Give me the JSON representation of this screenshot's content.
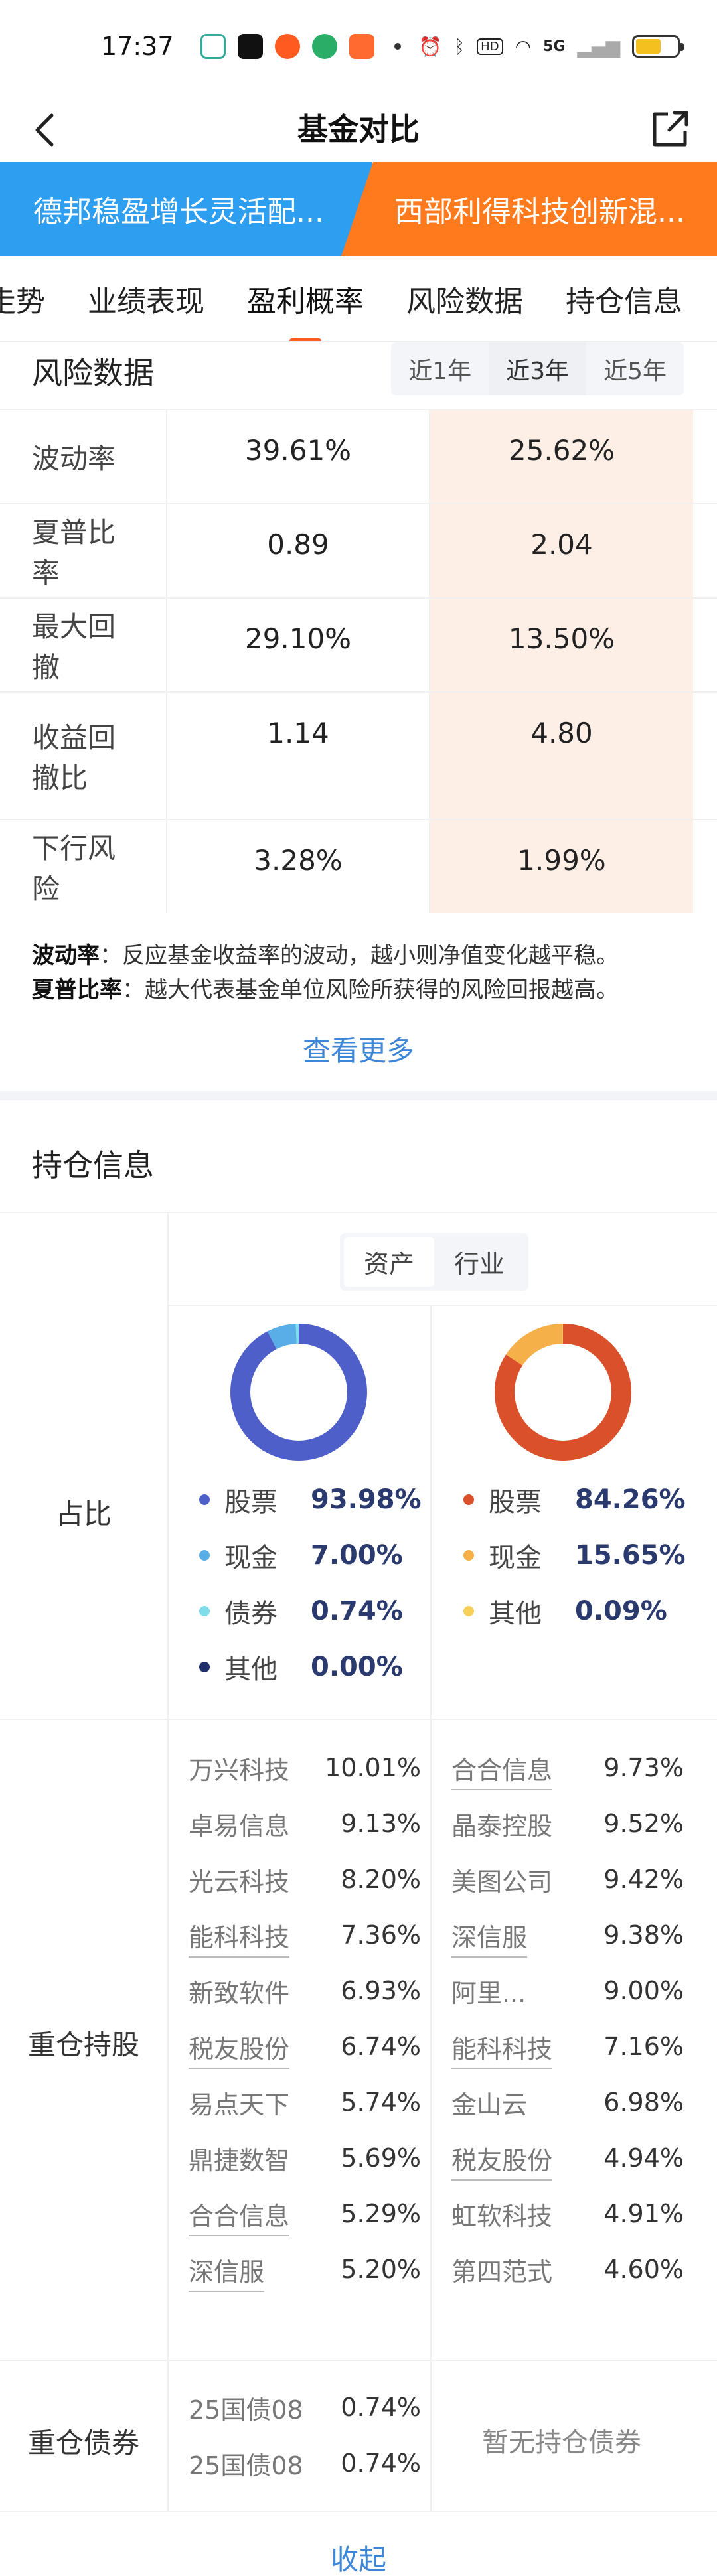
{
  "status_bar": {
    "time": "17:37",
    "net_label": "HD",
    "signal_label": "5G"
  },
  "header": {
    "title": "基金对比"
  },
  "funds": {
    "a": "德邦稳盈增长灵活配...",
    "b": "西部利得科技创新混..."
  },
  "tabs": [
    "走势",
    "业绩表现",
    "盈利概率",
    "风险数据",
    "持仓信息"
  ],
  "active_tab": "盈利概率",
  "risk": {
    "title": "风险数据",
    "periods": [
      "近1年",
      "近3年",
      "近5年"
    ],
    "selected_period": "近3年",
    "rows": [
      {
        "label": "波动率",
        "a": "39.61%",
        "b": "25.62%"
      },
      {
        "label": "夏普比率",
        "a": "0.89",
        "b": "2.04"
      },
      {
        "label": "最大回撤",
        "a": "29.10%",
        "b": "13.50%"
      },
      {
        "label": "收益回撤比",
        "a": "1.14",
        "b": "4.80"
      },
      {
        "label": "下行风险",
        "a": "3.28%",
        "b": "1.99%"
      }
    ],
    "notes": [
      {
        "term": "波动率",
        "text": "：反应基金收益率的波动，越小则净值变化越平稳。"
      },
      {
        "term": "夏普比率",
        "text": "：越大代表基金单位风险所获得的风险回报越高。"
      }
    ],
    "more_label": "查看更多"
  },
  "holdings": {
    "title": "持仓信息",
    "segments": [
      "资产",
      "行业"
    ],
    "selected_segment": "资产",
    "ratio_label": "占比",
    "fund_a_assets": [
      {
        "name": "股票",
        "pct": "93.98%",
        "color": "#4f5fc9"
      },
      {
        "name": "现金",
        "pct": "7.00%",
        "color": "#5aaee8"
      },
      {
        "name": "债券",
        "pct": "0.74%",
        "color": "#7fdde9"
      },
      {
        "name": "其他",
        "pct": "0.00%",
        "color": "#1f2d6b"
      }
    ],
    "fund_b_assets": [
      {
        "name": "股票",
        "pct": "84.26%",
        "color": "#d9502a"
      },
      {
        "name": "现金",
        "pct": "15.65%",
        "color": "#f5b04a"
      },
      {
        "name": "其他",
        "pct": "0.09%",
        "color": "#f7d05a"
      }
    ],
    "heavy_stock_label": "重仓持股",
    "fund_a_stocks": [
      {
        "name": "万兴科技",
        "pct": "10.01%",
        "link": false
      },
      {
        "name": "卓易信息",
        "pct": "9.13%",
        "link": false
      },
      {
        "name": "光云科技",
        "pct": "8.20%",
        "link": false
      },
      {
        "name": "能科科技",
        "pct": "7.36%",
        "link": true
      },
      {
        "name": "新致软件",
        "pct": "6.93%",
        "link": false
      },
      {
        "name": "税友股份",
        "pct": "6.74%",
        "link": true
      },
      {
        "name": "易点天下",
        "pct": "5.74%",
        "link": false
      },
      {
        "name": "鼎捷数智",
        "pct": "5.69%",
        "link": false
      },
      {
        "name": "合合信息",
        "pct": "5.29%",
        "link": true
      },
      {
        "name": "深信服",
        "pct": "5.20%",
        "link": true
      }
    ],
    "fund_b_stocks": [
      {
        "name": "合合信息",
        "pct": "9.73%",
        "link": true
      },
      {
        "name": "晶泰控股",
        "pct": "9.52%",
        "link": false
      },
      {
        "name": "美图公司",
        "pct": "9.42%",
        "link": false
      },
      {
        "name": "深信服",
        "pct": "9.38%",
        "link": true
      },
      {
        "name": "阿里...",
        "pct": "9.00%",
        "link": false
      },
      {
        "name": "能科科技",
        "pct": "7.16%",
        "link": true
      },
      {
        "name": "金山云",
        "pct": "6.98%",
        "link": false
      },
      {
        "name": "税友股份",
        "pct": "4.94%",
        "link": true
      },
      {
        "name": "虹软科技",
        "pct": "4.91%",
        "link": false
      },
      {
        "name": "第四范式",
        "pct": "4.60%",
        "link": false
      }
    ],
    "heavy_bond_label": "重仓债券",
    "fund_a_bonds": [
      {
        "name": "25国债08",
        "pct": "0.74%"
      },
      {
        "name": "25国债08",
        "pct": "0.74%"
      }
    ],
    "fund_b_bonds_empty": "暂无持仓债券",
    "collapse_label": "收起"
  }
}
